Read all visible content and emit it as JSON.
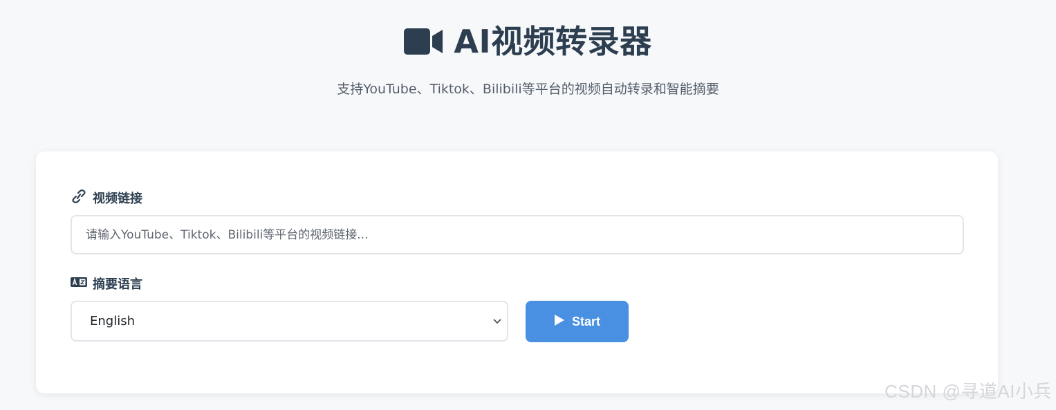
{
  "header": {
    "title": "AI视频转录器",
    "title_icon": "video-camera-icon",
    "subtitle": "支持YouTube、Tiktok、Bilibili等平台的视频自动转录和智能摘要"
  },
  "form": {
    "url_label": "视频链接",
    "url_label_icon": "link-icon",
    "url_placeholder": "请输入YouTube、Tiktok、Bilibili等平台的视频链接...",
    "url_value": "",
    "language_label": "摘要语言",
    "language_label_icon": "language-icon",
    "language_selected": "English",
    "start_label": "Start",
    "start_icon": "play-icon"
  },
  "watermark": "CSDN @寻道AI小兵",
  "colors": {
    "accent": "#4a90e2",
    "title": "#2c3e50",
    "background": "#f7f8fa",
    "card": "#ffffff"
  }
}
